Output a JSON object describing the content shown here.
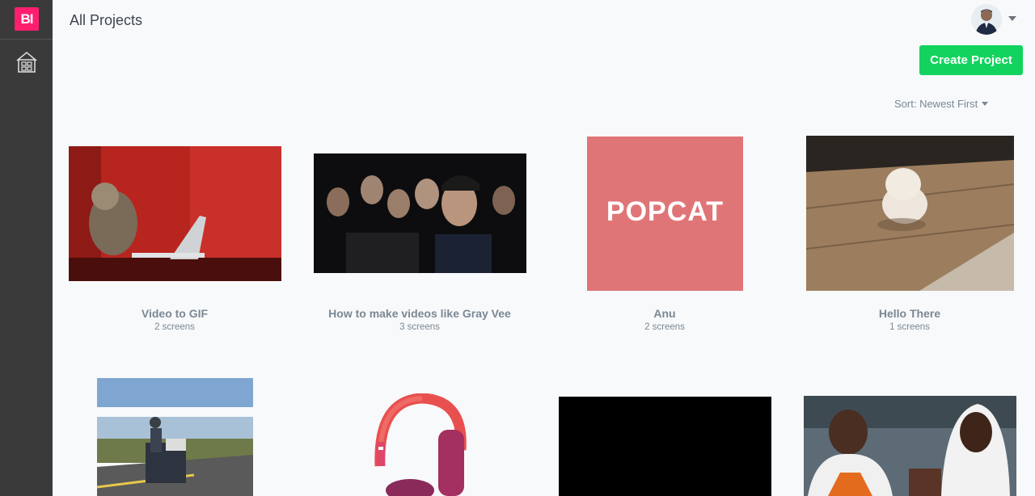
{
  "app": {
    "logo_text": "BI",
    "page_title": "All Projects"
  },
  "sidebar": {
    "items": [
      {
        "icon": "home-grid-icon"
      }
    ]
  },
  "header": {
    "create_button": "Create Project",
    "sort_label": "Sort: Newest First"
  },
  "colors": {
    "accent": "#12d35e",
    "brand": "#ff1f6e",
    "sidebar": "#3a3a3a",
    "popcat_bg": "#e07577"
  },
  "projects": [
    {
      "name": "Video to GIF",
      "screens": "2 screens",
      "thumb": "monkey-laptop-image"
    },
    {
      "name": "How to make videos like Gray Vee",
      "screens": "3 screens",
      "thumb": "crowd-image"
    },
    {
      "name": "Anu",
      "screens": "2 screens",
      "thumb": "popcat-image",
      "thumb_text": "POPCAT"
    },
    {
      "name": "Hello There",
      "screens": "1 screens",
      "thumb": "kitten-image"
    },
    {
      "thumb": "man-machine-road-image"
    },
    {
      "thumb": "headphones-image"
    },
    {
      "thumb": "black-video-image"
    },
    {
      "thumb": "football-players-image"
    }
  ]
}
